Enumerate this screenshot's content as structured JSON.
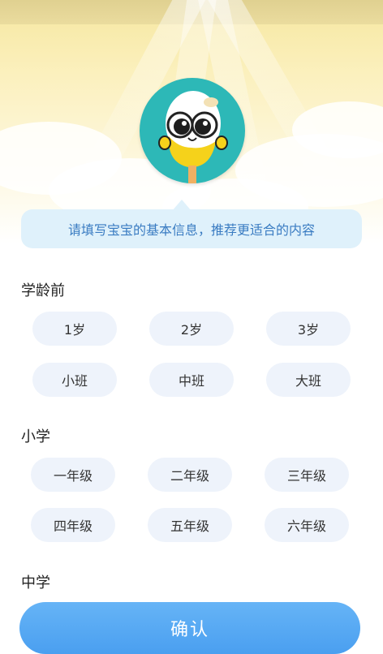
{
  "hero": {
    "bubble_text": "请填写宝宝的基本信息，推荐更适合的内容"
  },
  "sections": [
    {
      "title": "学龄前",
      "options": [
        "1岁",
        "2岁",
        "3岁",
        "小班",
        "中班",
        "大班"
      ]
    },
    {
      "title": "小学",
      "options": [
        "一年级",
        "二年级",
        "三年级",
        "四年级",
        "五年级",
        "六年级"
      ]
    },
    {
      "title": "中学",
      "options": []
    }
  ],
  "confirm_label": "确认",
  "colors": {
    "accent": "#4a9ff0",
    "chip_bg": "#eef3fb",
    "bubble_bg": "#dff1fb",
    "bubble_text": "#3a7cc2",
    "avatar_bg": "#2db8b7"
  },
  "icons": {
    "mascot": "egg-mascot-icon"
  }
}
